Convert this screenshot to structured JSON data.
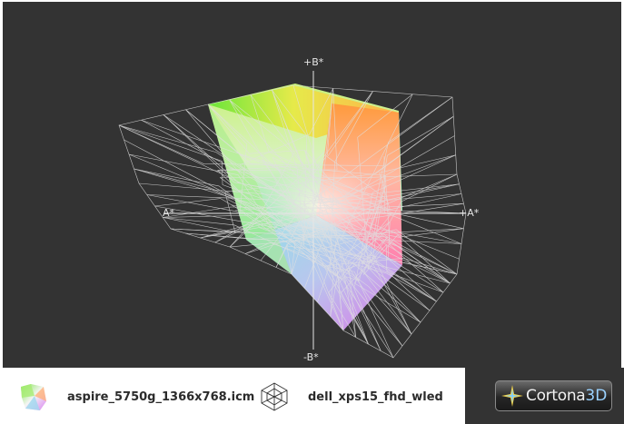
{
  "viewer": {
    "axis_labels": {
      "plus_b": "+B*",
      "minus_b": "-B*",
      "plus_a": "+A*",
      "minus_a": "A*"
    }
  },
  "legend": {
    "items": [
      {
        "label": "aspire_5750g_1366x768.icm",
        "icon": "color-gamut-solid-icon"
      },
      {
        "label": "dell_xps15_fhd_wled",
        "icon": "wireframe-gamut-icon"
      }
    ]
  },
  "branding": {
    "name": "Cortona",
    "suffix": "3D",
    "icon": "cortona-star-icon"
  },
  "colors": {
    "viewport_background": "#333333",
    "wireframe": "#e0e0e0",
    "accent_3d": "#9ad2ff"
  }
}
